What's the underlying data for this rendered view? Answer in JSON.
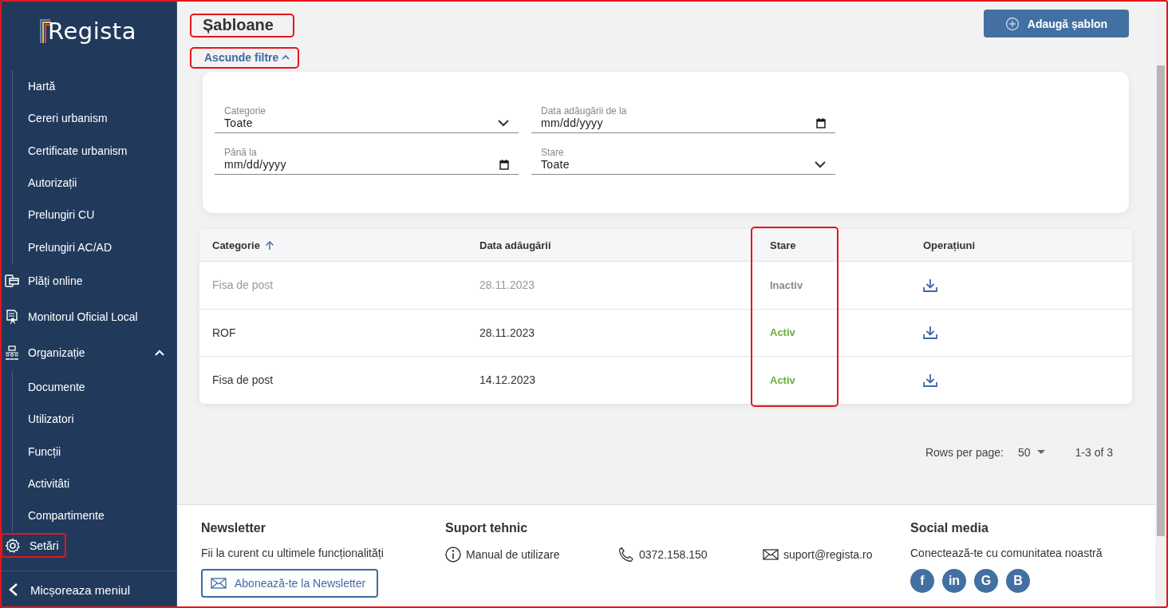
{
  "window": {
    "highlighted": true
  },
  "sidebar": {
    "logo": "Regista",
    "top_submenu": [
      "Hartă",
      "Cereri urbanism",
      "Certificate urbanism",
      "Autorizații",
      "Prelungiri CU",
      "Prelungiri AC/AD"
    ],
    "items": [
      {
        "label": "Plăți online",
        "kind": "payment",
        "highlighted": false
      },
      {
        "label": "Monitorul Oficial Local",
        "kind": "document",
        "highlighted": false
      },
      {
        "label": "Organizație",
        "kind": "organization",
        "highlighted": false,
        "expanded": true,
        "children": [
          "Documente",
          "Utilizatori",
          "Funcții",
          "Activitâti",
          "Compartimente"
        ]
      },
      {
        "label": "Setări",
        "kind": "settings",
        "highlighted": true
      }
    ],
    "collapse": "Micșoreaza meniul"
  },
  "page": {
    "title": "Șabloane",
    "title_highlighted": true,
    "add_button": "Adaugă șablon",
    "filter_toggle": "Ascunde filtre",
    "filter_toggle_highlighted": true,
    "filters_expanded": true
  },
  "filters": [
    {
      "label": "Categorie",
      "kind": "select",
      "value": "Toate"
    },
    {
      "label": "Data adăugării de la",
      "kind": "date",
      "value": "mm/dd/yyyy"
    },
    {
      "label": "Până la",
      "kind": "date",
      "value": "mm/dd/yyyy"
    },
    {
      "label": "Stare",
      "kind": "select",
      "value": "Toate"
    }
  ],
  "table": {
    "columns": [
      {
        "label": "Categorie",
        "sorted": true,
        "highlighted": false
      },
      {
        "label": "Data adăugării",
        "sorted": false,
        "highlighted": false
      },
      {
        "label": "Stare",
        "sorted": false,
        "highlighted": true
      },
      {
        "label": "Operațiuni",
        "sorted": false,
        "highlighted": false
      }
    ],
    "rows": [
      {
        "category": "Fisa de post",
        "date": "28.11.2023",
        "status": "Inactiv",
        "active": false
      },
      {
        "category": "ROF",
        "date": "28.11.2023",
        "status": "Activ",
        "active": true
      },
      {
        "category": "Fisa de post",
        "date": "14.12.2023",
        "status": "Activ",
        "active": true
      }
    ]
  },
  "pagination": {
    "rows_label": "Rows per page:",
    "rows_value": "50",
    "range": "1-3 of 3"
  },
  "footer": {
    "newsletter_title": "Newsletter",
    "newsletter_text": "Fii la curent cu ultimele funcționalități",
    "newsletter_button": "Abonează-te la Newsletter",
    "support_title": "Suport tehnic",
    "support_items": [
      {
        "kind": "info",
        "text": "Manual de utilizare"
      },
      {
        "kind": "phone",
        "text": "0372.158.150"
      },
      {
        "kind": "mail",
        "text": "suport@regista.ro"
      }
    ],
    "social_title": "Social media",
    "social_text": "Conectează-te cu comunitatea noastră",
    "social": [
      {
        "glyph": "f"
      },
      {
        "glyph": "in"
      },
      {
        "glyph": "G"
      },
      {
        "glyph": "B"
      }
    ]
  }
}
